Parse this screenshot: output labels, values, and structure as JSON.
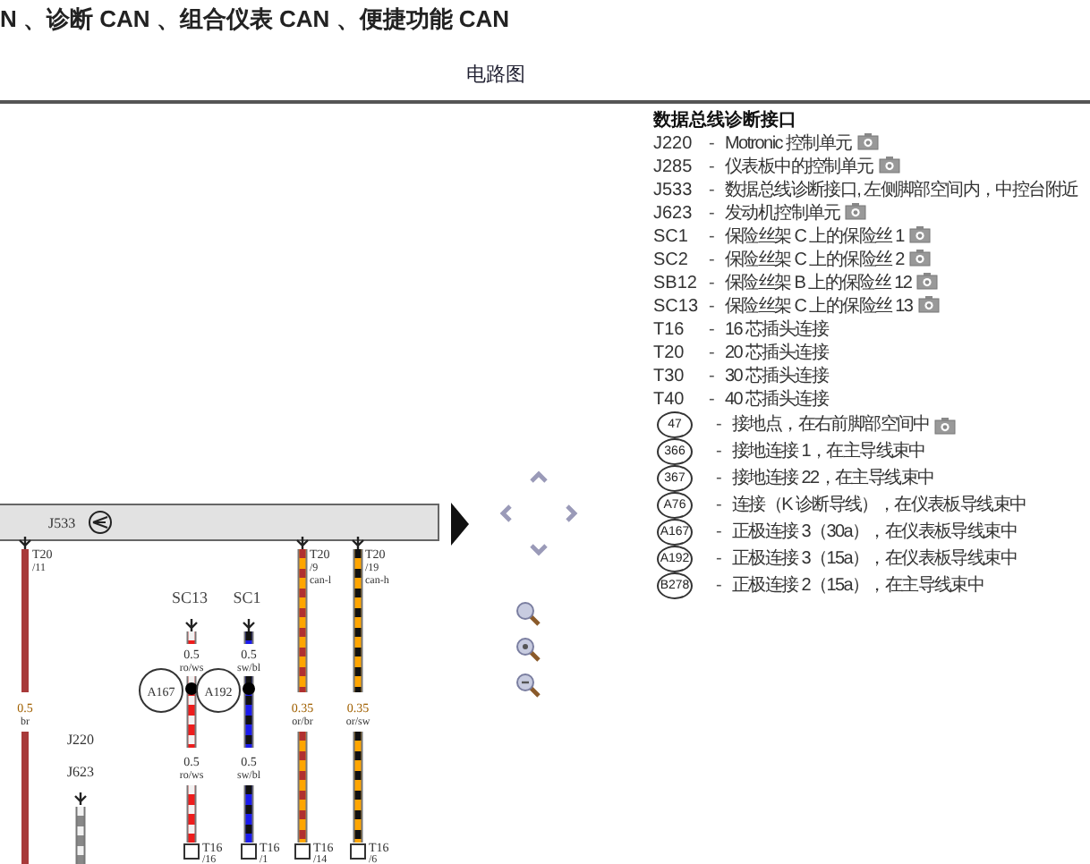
{
  "title": "N 、诊断 CAN 、组合仪表 CAN 、便捷功能 CAN",
  "view_title": "电路图",
  "diagram": {
    "module": "J533",
    "wires": [
      {
        "kind": "bus",
        "top_pin": "T20",
        "top_pin_no": "/11",
        "gauge": "0.5",
        "code": "br",
        "color": "#a83a3a"
      },
      {
        "kind": "fuse",
        "fuse": "SC13",
        "gauge": "0.5",
        "code": "ro/ws",
        "junction": "A167",
        "gauge_2": "0.5",
        "code_2": "ro/ws",
        "end_pin": "T16",
        "end_pin_no": "/16",
        "color": "#ee1c1c",
        "stripe": {
          "color": "#f2f2f2"
        }
      },
      {
        "kind": "fuse",
        "fuse": "SC1",
        "gauge": "0.5",
        "code": "sw/bl",
        "junction": "A192",
        "gauge_2": "0.5",
        "code_2": "sw/bl",
        "end_pin": "T16",
        "end_pin_no": "/1",
        "color": "#1a1aee",
        "stripe": {
          "color": "#111111"
        }
      },
      {
        "kind": "bus",
        "top_pin": "T20",
        "top_pin_no": "/9",
        "signal": "can-l",
        "gauge": "0.35",
        "code": "or/br",
        "end_pin": "T16",
        "end_pin_no": "/14",
        "color": "#ffa500",
        "stripe": {
          "color": "#b03030"
        }
      },
      {
        "kind": "bus",
        "top_pin": "T20",
        "top_pin_no": "/19",
        "signal": "can-h",
        "gauge": "0.35",
        "code": "or/sw",
        "end_pin": "T16",
        "end_pin_no": "/6",
        "color": "#ffa500",
        "stripe": {
          "color": "#111111"
        }
      },
      {
        "kind": "ground",
        "labels": [
          "J220",
          "J623"
        ],
        "color": "#888888",
        "stripe": {
          "color": "#f2f2f2"
        }
      }
    ]
  },
  "legend": {
    "heading": "数据总线诊断接口",
    "items": [
      {
        "kind": "code",
        "code": "J220",
        "dash": "-",
        "text": "Motronic 控制单元",
        "photo": true
      },
      {
        "kind": "code",
        "code": "J285",
        "dash": "-",
        "text": "仪表板中的控制单元",
        "photo": true
      },
      {
        "kind": "code",
        "code": "J533",
        "dash": "-",
        "text": "数据总线诊断接口, 左侧脚部空间内，中控台附近",
        "photo": false
      },
      {
        "kind": "code",
        "code": "J623",
        "dash": "-",
        "text": "发动机控制单元",
        "photo": true
      },
      {
        "kind": "code",
        "code": "SC1",
        "dash": "-",
        "text": "保险丝架 C 上的保险丝 1",
        "photo": true
      },
      {
        "kind": "code",
        "code": "SC2",
        "dash": "-",
        "text": "保险丝架 C 上的保险丝 2",
        "photo": true
      },
      {
        "kind": "code",
        "code": "SB12",
        "dash": "-",
        "text": "保险丝架 B 上的保险丝 12",
        "photo": true
      },
      {
        "kind": "code",
        "code": "SC13",
        "dash": "-",
        "text": "保险丝架 C 上的保险丝 13",
        "photo": true
      },
      {
        "kind": "code",
        "code": "T16",
        "dash": "-",
        "text": "16 芯插头连接",
        "photo": false
      },
      {
        "kind": "code",
        "code": "T20",
        "dash": "-",
        "text": "20 芯插头连接",
        "photo": false
      },
      {
        "kind": "code",
        "code": "T30",
        "dash": "-",
        "text": "30 芯插头连接",
        "photo": false
      },
      {
        "kind": "code",
        "code": "T40",
        "dash": "-",
        "text": "40 芯插头连接",
        "photo": false
      },
      {
        "kind": "circle",
        "code": "47",
        "dash": "-",
        "text": "接地点，在右前脚部空间中",
        "photo": true
      },
      {
        "kind": "circle",
        "code": "366",
        "dash": "-",
        "text": "接地连接 1，在主导线束中",
        "photo": false
      },
      {
        "kind": "circle",
        "code": "367",
        "dash": "-",
        "text": "接地连接 22，在主导线束中",
        "photo": false
      },
      {
        "kind": "circle",
        "code": "A76",
        "dash": "-",
        "text": "连接（K 诊断导线），在仪表板导线束中",
        "photo": false
      },
      {
        "kind": "circle",
        "code": "A167",
        "dash": "-",
        "text": "正极连接 3（30a），在仪表板导线束中",
        "photo": false
      },
      {
        "kind": "circle",
        "code": "A192",
        "dash": "-",
        "text": "正极连接 3（15a），在仪表板导线束中",
        "photo": false
      },
      {
        "kind": "circle",
        "code": "B278",
        "dash": "-",
        "text": "正极连接 2（15a），在主导线束中",
        "photo": false
      }
    ]
  }
}
